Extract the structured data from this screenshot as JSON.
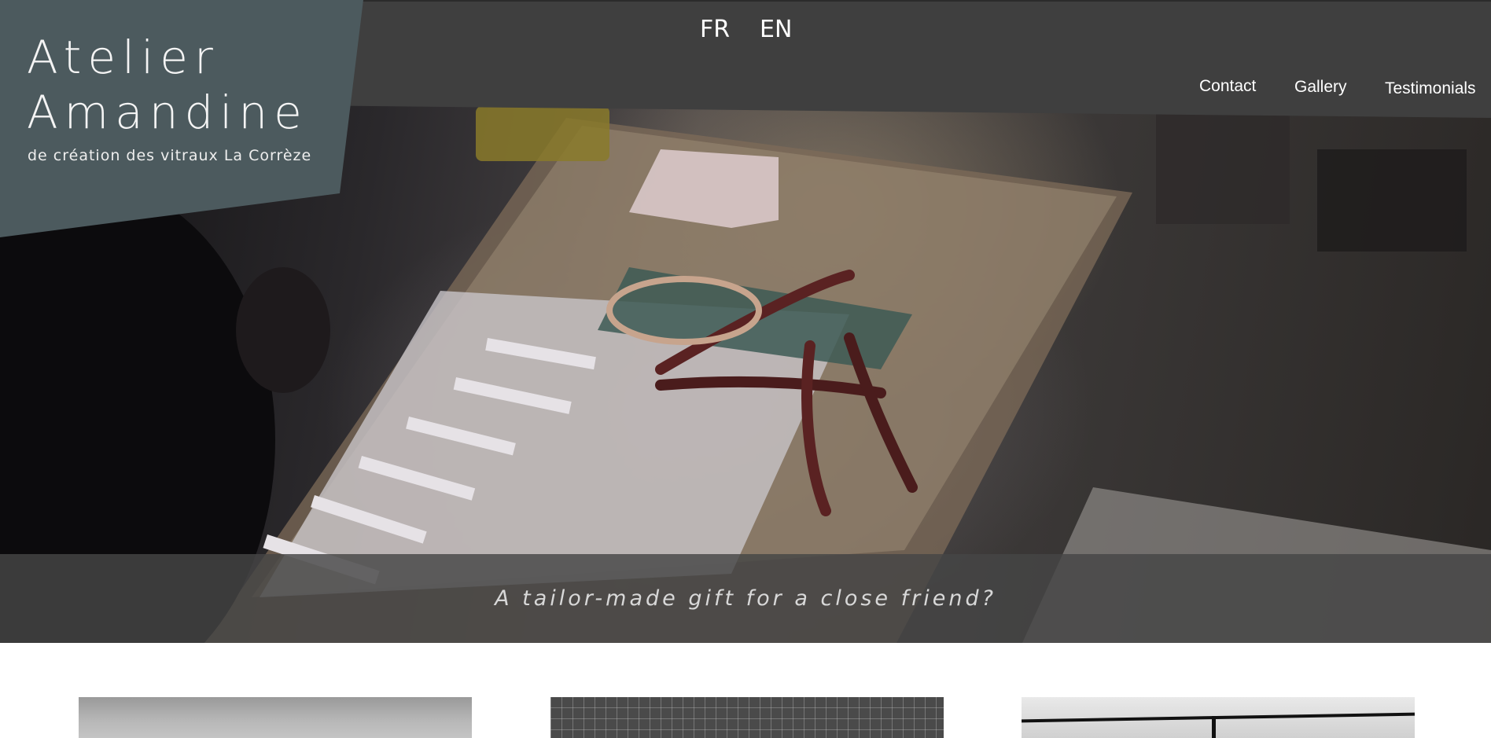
{
  "brand": {
    "title_line1": "Atelier",
    "title_line2": "Amandine",
    "subtitle": "de création des vitraux La Corrèze",
    "panel_color": "#4c5a5e"
  },
  "languages": [
    "FR",
    "EN"
  ],
  "nav": {
    "contact": "Contact",
    "gallery": "Gallery",
    "testimonials": "Testimonials"
  },
  "hero": {
    "caption": "A tailor-made gift for a close friend?"
  },
  "colors": {
    "topbar": "#3f3f3f",
    "caption_band": "#464646",
    "page_background": "#ffffff"
  }
}
